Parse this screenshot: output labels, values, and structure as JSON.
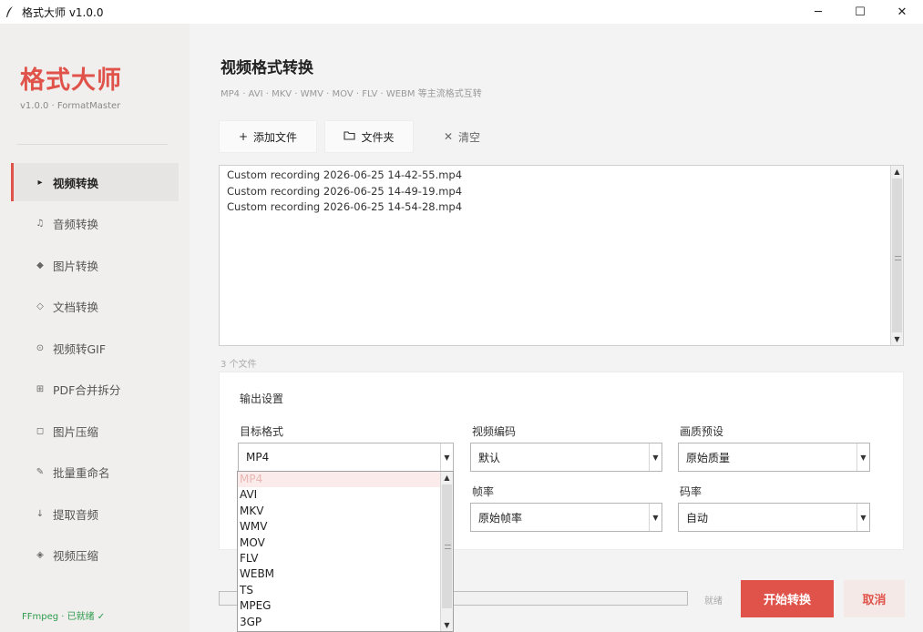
{
  "window": {
    "title": "格式大师 v1.0.0",
    "minimize": "─",
    "maximize": "☐",
    "close": "✕"
  },
  "sidebar": {
    "brand": "格式大师",
    "version": "v1.0.0 · FormatMaster",
    "items": [
      {
        "icon": "▸",
        "label": "视频转换"
      },
      {
        "icon": "♫",
        "label": "音频转换"
      },
      {
        "icon": "◆",
        "label": "图片转换"
      },
      {
        "icon": "◇",
        "label": "文档转换"
      },
      {
        "icon": "⊙",
        "label": "视频转GIF"
      },
      {
        "icon": "⊞",
        "label": "PDF合并拆分"
      },
      {
        "icon": "◻",
        "label": "图片压缩"
      },
      {
        "icon": "✎",
        "label": "批量重命名"
      },
      {
        "icon": "↓",
        "label": "提取音频"
      },
      {
        "icon": "◈",
        "label": "视频压缩"
      }
    ],
    "active_index": 0,
    "ffmpeg_status": "FFmpeg · 已就绪 ✓"
  },
  "main": {
    "title": "视频格式转换",
    "subtitle": "MP4 · AVI · MKV · WMV · MOV · FLV · WEBM 等主流格式互转",
    "toolbar": {
      "add_icon": "+",
      "add_label": "添加文件",
      "folder_icon": "🗀",
      "folder_label": "文件夹",
      "clear_icon": "✕",
      "clear_label": "清空"
    },
    "files": [
      "Custom recording 2026-06-25 14-42-55.mp4",
      "Custom recording 2026-06-25 14-49-19.mp4",
      "Custom recording 2026-06-25 14-54-28.mp4"
    ],
    "file_count": "3 个文件",
    "settings": {
      "title": "输出设置",
      "target_format_label": "目标格式",
      "target_format_value": "MP4",
      "video_codec_label": "视频编码",
      "video_codec_value": "默认",
      "quality_label": "画质预设",
      "quality_value": "原始质量",
      "fps_label": "帧率",
      "fps_value": "原始帧率",
      "bitrate_label": "码率",
      "bitrate_value": "自动"
    },
    "format_options": [
      "MP4",
      "AVI",
      "MKV",
      "WMV",
      "MOV",
      "FLV",
      "WEBM",
      "TS",
      "MPEG",
      "3GP"
    ],
    "progress": 0,
    "status": "就绪",
    "start_label": "开始转换",
    "cancel_label": "取消"
  },
  "colors": {
    "accent": "#e0534a",
    "success": "#2e9b4e"
  }
}
